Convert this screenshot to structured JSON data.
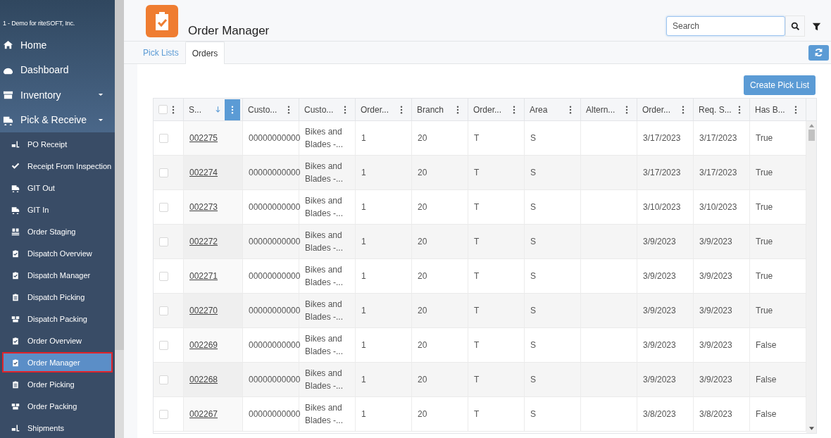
{
  "sidebar": {
    "company": "1 - Demo for riteSOFT, Inc.",
    "items": [
      {
        "label": "Home",
        "caret": false,
        "selected": false
      },
      {
        "label": "Dashboard",
        "caret": false,
        "selected": false
      },
      {
        "label": "Inventory",
        "caret": true,
        "selected": false
      },
      {
        "label": "Pick & Receive",
        "caret": true,
        "selected": false,
        "children": [
          {
            "label": "PO Receipt",
            "selected": false
          },
          {
            "label": "Receipt From Inspection",
            "selected": false
          },
          {
            "label": "GIT Out",
            "selected": false
          },
          {
            "label": "GIT In",
            "selected": false
          },
          {
            "label": "Order Staging",
            "selected": false
          },
          {
            "label": "Dispatch Overview",
            "selected": false
          },
          {
            "label": "Dispatch Manager",
            "selected": false
          },
          {
            "label": "Dispatch Picking",
            "selected": false
          },
          {
            "label": "Dispatch Packing",
            "selected": false
          },
          {
            "label": "Order Overview",
            "selected": false
          },
          {
            "label": "Order Manager",
            "selected": true
          },
          {
            "label": "Order Picking",
            "selected": false
          },
          {
            "label": "Order Packing",
            "selected": false
          },
          {
            "label": "Shipments",
            "selected": false
          }
        ]
      }
    ]
  },
  "header": {
    "title": "Order Manager",
    "search": {
      "placeholder": "Search"
    }
  },
  "tabs": [
    {
      "label": "Pick Lists",
      "selected": false
    },
    {
      "label": "Orders",
      "selected": true
    }
  ],
  "create_button": "Create Pick List",
  "table": {
    "header_checked": false,
    "columns": [
      {
        "label": "S...",
        "sorted_descending": true,
        "menu_active": true
      },
      {
        "label": "Custo...",
        "sorted_descending": false,
        "menu_active": false
      },
      {
        "label": "Custo...",
        "sorted_descending": false,
        "menu_active": false
      },
      {
        "label": "Order...",
        "sorted_descending": false,
        "menu_active": false
      },
      {
        "label": "Branch",
        "sorted_descending": false,
        "menu_active": false
      },
      {
        "label": "Order...",
        "sorted_descending": false,
        "menu_active": false
      },
      {
        "label": "Area",
        "sorted_descending": false,
        "menu_active": false
      },
      {
        "label": "Altern...",
        "sorted_descending": false,
        "menu_active": false
      },
      {
        "label": "Order...",
        "sorted_descending": false,
        "menu_active": false
      },
      {
        "label": "Req. S...",
        "sorted_descending": false,
        "menu_active": false
      },
      {
        "label": "Has B...",
        "sorted_descending": false,
        "menu_active": false
      }
    ],
    "rows": [
      {
        "checked": false,
        "cells": [
          "002275",
          "00000000000",
          "Bikes and Blades -...",
          "1",
          "20",
          "T",
          "S",
          null,
          "3/17/2023",
          "3/17/2023",
          "True"
        ]
      },
      {
        "checked": false,
        "cells": [
          "002274",
          "00000000000",
          "Bikes and Blades -...",
          "1",
          "20",
          "T",
          "S",
          null,
          "3/17/2023",
          "3/17/2023",
          "True"
        ]
      },
      {
        "checked": false,
        "cells": [
          "002273",
          "00000000000",
          "Bikes and Blades -...",
          "1",
          "20",
          "T",
          "S",
          null,
          "3/10/2023",
          "3/10/2023",
          "True"
        ]
      },
      {
        "checked": false,
        "cells": [
          "002272",
          "00000000000",
          "Bikes and Blades -...",
          "1",
          "20",
          "T",
          "S",
          null,
          "3/9/2023",
          "3/9/2023",
          "True"
        ]
      },
      {
        "checked": false,
        "cells": [
          "002271",
          "00000000000",
          "Bikes and Blades -...",
          "1",
          "20",
          "T",
          "S",
          null,
          "3/9/2023",
          "3/9/2023",
          "True"
        ]
      },
      {
        "checked": false,
        "cells": [
          "002270",
          "00000000000",
          "Bikes and Blades -...",
          "1",
          "20",
          "T",
          "S",
          null,
          "3/9/2023",
          "3/9/2023",
          "True"
        ]
      },
      {
        "checked": false,
        "cells": [
          "002269",
          "00000000000",
          "Bikes and Blades -...",
          "1",
          "20",
          "T",
          "S",
          null,
          "3/9/2023",
          "3/9/2023",
          "False"
        ]
      },
      {
        "checked": false,
        "cells": [
          "002268",
          "00000000000",
          "Bikes and Blades -...",
          "1",
          "20",
          "T",
          "S",
          null,
          "3/9/2023",
          "3/9/2023",
          "False"
        ]
      },
      {
        "checked": false,
        "cells": [
          "002267",
          "00000000000",
          "Bikes and Blades -...",
          "1",
          "20",
          "T",
          "S",
          null,
          "3/8/2023",
          "3/8/2023",
          "False"
        ]
      }
    ]
  }
}
